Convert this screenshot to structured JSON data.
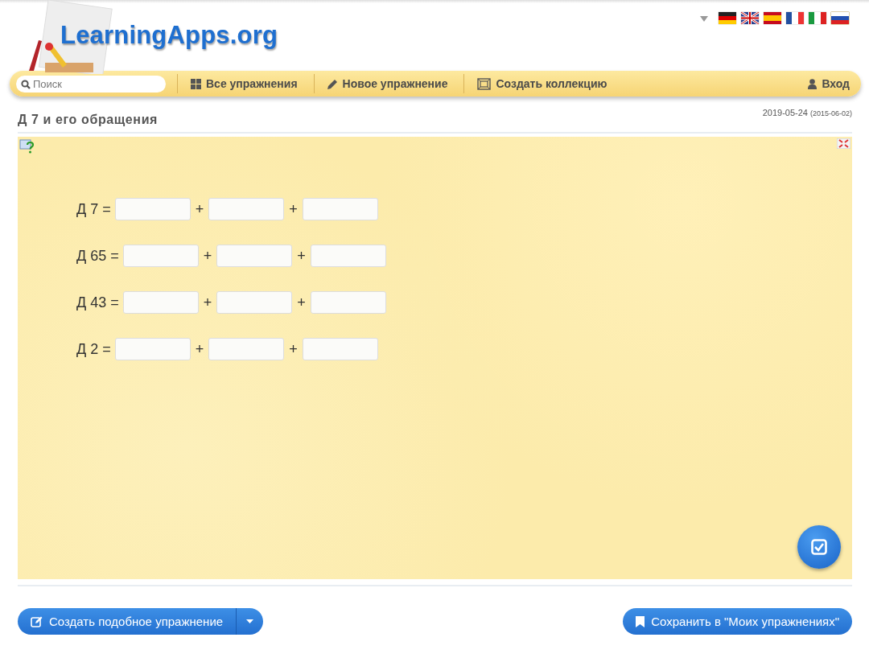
{
  "header": {
    "logo": "LearningApps.org",
    "language_flags": [
      {
        "kind": "de",
        "selected": false
      },
      {
        "kind": "gb",
        "selected": false
      },
      {
        "kind": "es",
        "selected": false
      },
      {
        "kind": "fr",
        "selected": false
      },
      {
        "kind": "it",
        "selected": false
      },
      {
        "kind": "ru",
        "selected": true
      }
    ]
  },
  "nav": {
    "search": {
      "placeholder": "Поиск"
    },
    "items": [
      {
        "label": "Все упражнения",
        "kind": "grid"
      },
      {
        "label": "Новое упражнение",
        "kind": "pencil"
      },
      {
        "label": "Создать коллекцию",
        "kind": "collection"
      }
    ],
    "login": "Вход"
  },
  "exercise": {
    "title": "Д 7 и его обращения",
    "date": "2019-05-24",
    "original_date": "(2015-06-02)"
  },
  "equations": [
    {
      "label": "Д 7 =",
      "plus": [
        "+",
        "+"
      ]
    },
    {
      "label": "Д 65 =",
      "plus": [
        "+",
        "+"
      ]
    },
    {
      "label": "Д 43 =",
      "plus": [
        "+",
        "+"
      ]
    },
    {
      "label": "Д 2 =",
      "plus": [
        "+",
        "+"
      ]
    }
  ],
  "buttons": {
    "create_similar": "Создать подобное упражнение",
    "save": "Сохранить в \"Моих упражнениях\""
  }
}
